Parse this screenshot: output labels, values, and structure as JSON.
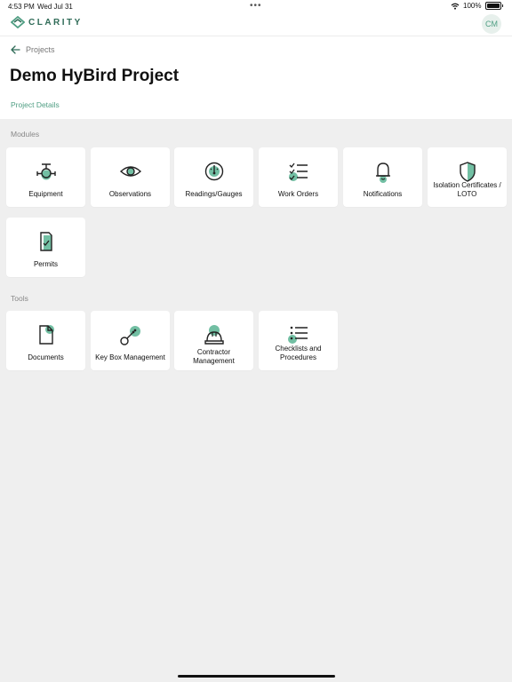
{
  "status": {
    "time": "4:53 PM",
    "date": "Wed Jul 31",
    "battery": "100%"
  },
  "app": {
    "brand": "CLARITY",
    "avatar_initials": "CM"
  },
  "breadcrumb": {
    "back_label": "Projects"
  },
  "project": {
    "title": "Demo HyBird Project",
    "details_link": "Project Details"
  },
  "modules": {
    "title": "Modules",
    "items": [
      {
        "label": "Equipment",
        "icon": "valve-icon"
      },
      {
        "label": "Observations",
        "icon": "eye-icon"
      },
      {
        "label": "Readings/Gauges",
        "icon": "gauge-icon"
      },
      {
        "label": "Work Orders",
        "icon": "checklist-icon"
      },
      {
        "label": "Notifications",
        "icon": "bell-icon"
      },
      {
        "label": "Isolation Certificates / LOTO",
        "icon": "shield-icon"
      },
      {
        "label": "Permits",
        "icon": "permit-icon"
      }
    ]
  },
  "tools": {
    "title": "Tools",
    "items": [
      {
        "label": "Documents",
        "icon": "document-icon"
      },
      {
        "label": "Key Box Management",
        "icon": "key-icon"
      },
      {
        "label": "Contractor Management",
        "icon": "hard-hat-icon"
      },
      {
        "label": "Checklists and Procedures",
        "icon": "list-icon"
      }
    ]
  },
  "colors": {
    "accent": "#4f9e83",
    "accent_light": "#72bfa3",
    "brand": "#2f6b57"
  }
}
